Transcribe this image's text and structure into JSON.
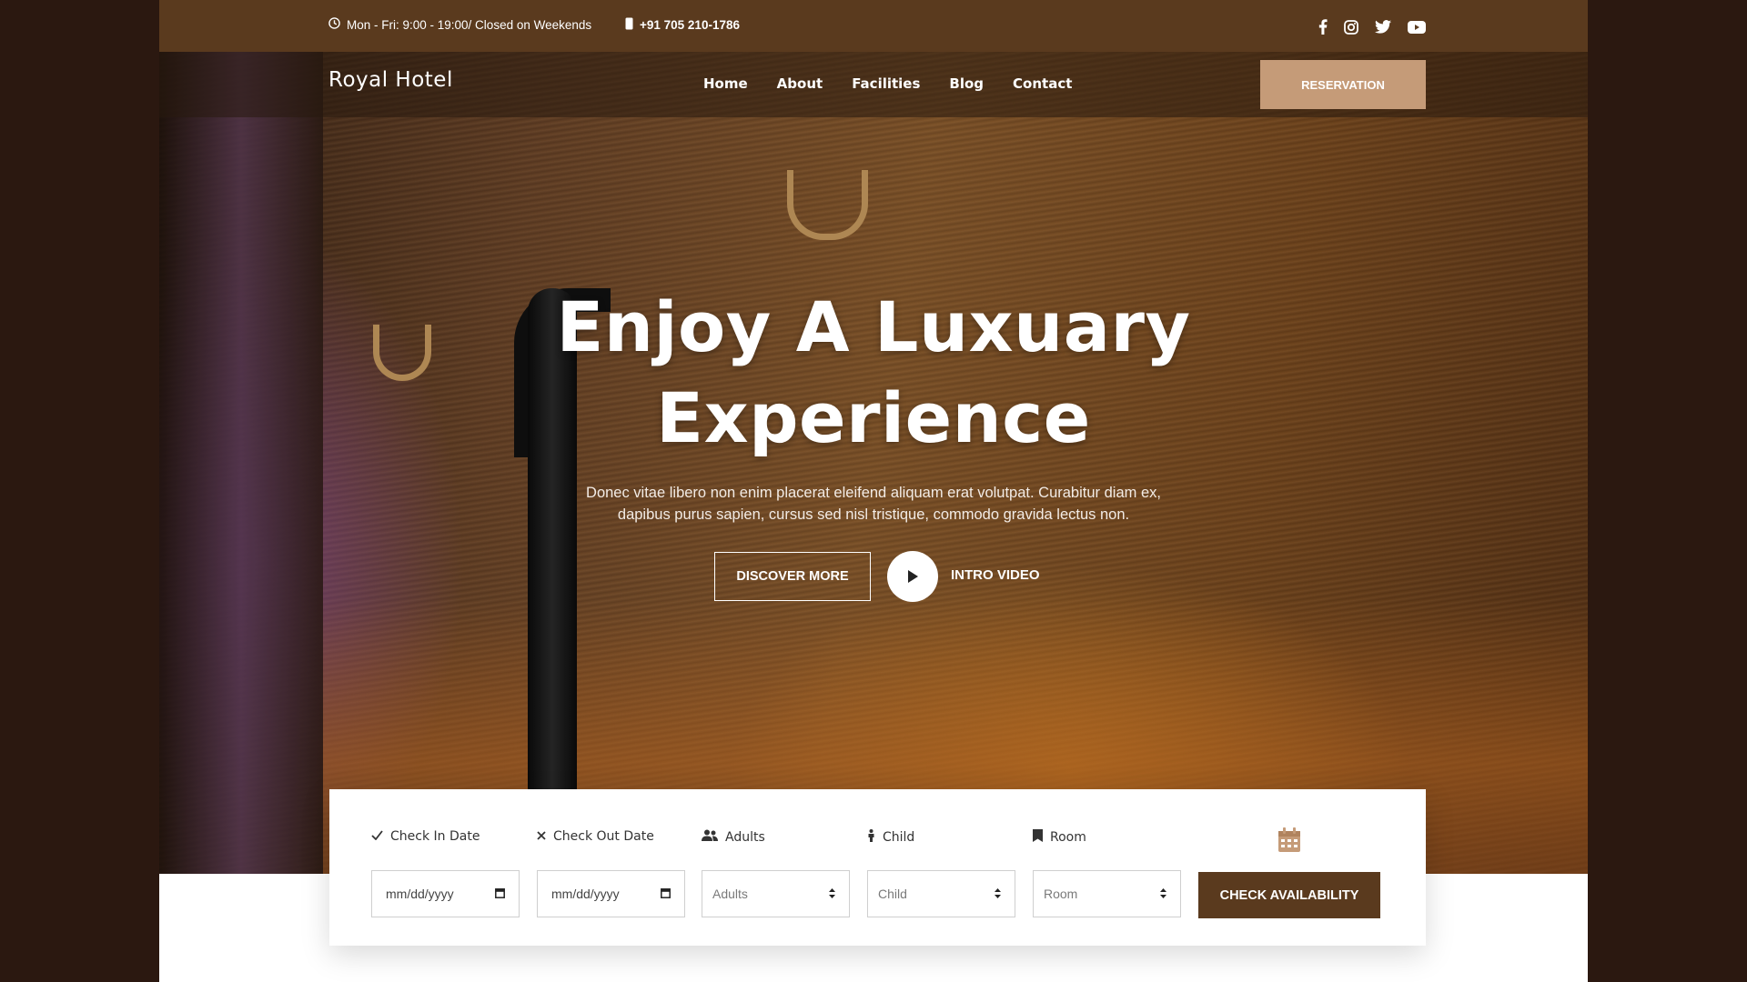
{
  "topbar": {
    "hours": "Mon - Fri: 9:00 - 19:00/ Closed on Weekends",
    "phone": "+91 705 210-1786"
  },
  "icons": {
    "clock": "clock-icon",
    "phone": "phone-icon",
    "social": [
      "facebook-icon",
      "instagram-icon",
      "twitter-icon",
      "youtube-icon"
    ],
    "calendar": "calendar-icon"
  },
  "nav": {
    "logo": "Royal Hotel",
    "links": [
      "Home",
      "About",
      "Facilities",
      "Blog",
      "Contact"
    ],
    "reservation": "RESERVATION"
  },
  "hero": {
    "title_line1": "Enjoy A Luxuary",
    "title_line2": "Experience",
    "subtitle": "Donec vitae libero non enim placerat eleifend aliquam erat volutpat. Curabitur diam ex, dapibus purus sapien, cursus sed nisl tristique, commodo gravida lectus non.",
    "discover": "DISCOVER MORE",
    "intro": "INTRO VIDEO"
  },
  "booking": {
    "checkin_label": "Check In Date",
    "checkout_label": "Check Out Date",
    "adults_label": "Adults",
    "child_label": "Child",
    "room_label": "Room",
    "checkin_value": "mm/dd/yyyy",
    "checkout_value": "mm/dd/yyyy",
    "adults_value": "Adults",
    "child_value": "Child",
    "room_value": "Room",
    "button": "CHECK AVAILABILITY"
  },
  "colors": {
    "brand_dark": "#5a3a1e",
    "brand_light": "#c59b78",
    "backdrop": "#2b1810"
  }
}
